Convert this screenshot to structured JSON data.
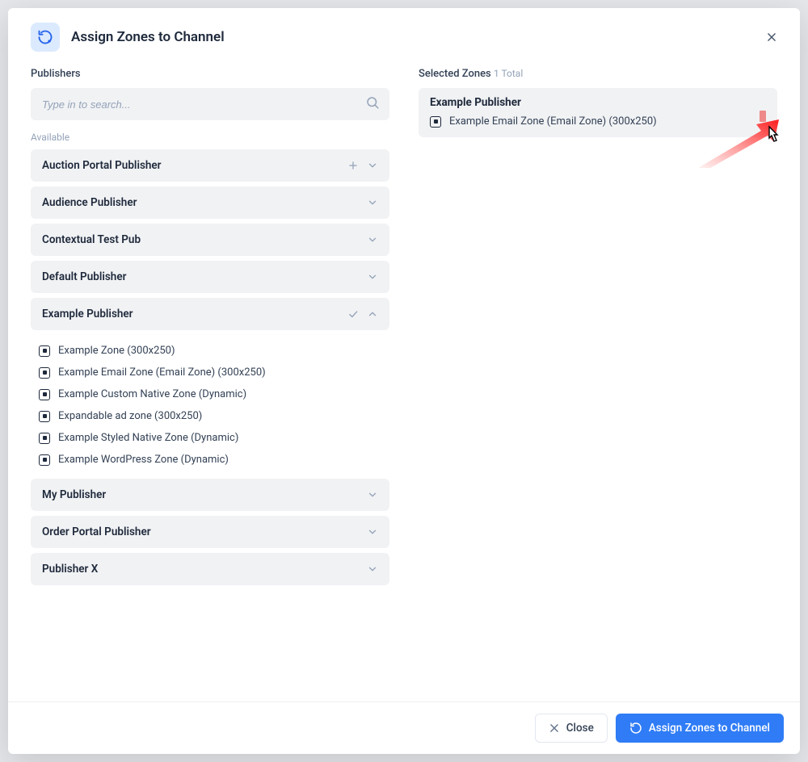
{
  "header": {
    "title": "Assign Zones to Channel"
  },
  "left": {
    "section_label": "Publishers",
    "search_placeholder": "Type in to search...",
    "available_label": "Available",
    "publishers": [
      {
        "name": "Auction Portal Publisher",
        "expanded": false,
        "has_plus": true
      },
      {
        "name": "Audience Publisher",
        "expanded": false,
        "has_plus": false
      },
      {
        "name": "Contextual Test Pub",
        "expanded": false,
        "has_plus": false
      },
      {
        "name": "Default Publisher",
        "expanded": false,
        "has_plus": false
      },
      {
        "name": "Example Publisher",
        "expanded": true,
        "has_plus": false,
        "has_check": true,
        "zones": [
          "Example Zone (300x250)",
          "Example Email Zone (Email Zone) (300x250)",
          "Example Custom Native Zone (Dynamic)",
          "Expandable ad zone (300x250)",
          "Example Styled Native Zone (Dynamic)",
          "Example WordPress Zone (Dynamic)"
        ]
      },
      {
        "name": "My Publisher",
        "expanded": false,
        "has_plus": false
      },
      {
        "name": "Order Portal Publisher",
        "expanded": false,
        "has_plus": false
      },
      {
        "name": "Publisher X",
        "expanded": false,
        "has_plus": false
      }
    ]
  },
  "right": {
    "section_label": "Selected Zones",
    "total_suffix": "1 Total",
    "groups": [
      {
        "publisher": "Example Publisher",
        "zones": [
          "Example Email Zone (Email Zone) (300x250)"
        ]
      }
    ]
  },
  "footer": {
    "close_label": "Close",
    "assign_label": "Assign Zones to Channel"
  }
}
